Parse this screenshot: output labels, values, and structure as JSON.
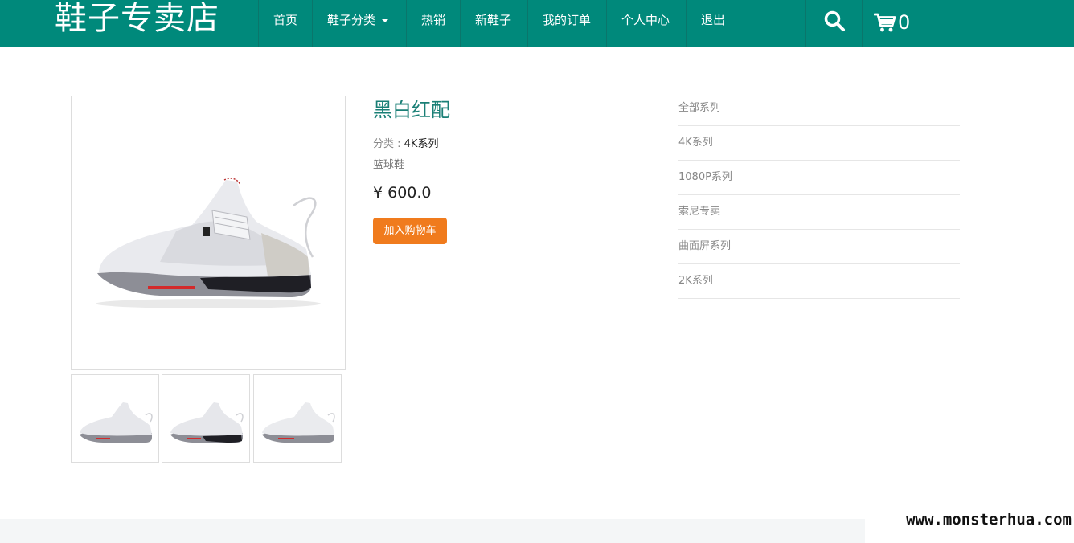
{
  "brand": "鞋子专卖店",
  "nav": {
    "items": [
      "首页",
      "鞋子分类",
      "热销",
      "新鞋子",
      "我的订单",
      "个人中心",
      "退出"
    ],
    "cart_count": "0",
    "search_icon": "search-icon",
    "cart_icon": "cart-icon"
  },
  "colors": {
    "nav_bg": "#00897b",
    "title": "#1a7f76",
    "button": "#f07b1d"
  },
  "product": {
    "title": "黑白红配",
    "category_label": "分类 : ",
    "category_value": "4K系列",
    "subtitle": "篮球鞋",
    "price": "¥ 600.0",
    "add_to_cart": "加入购物车"
  },
  "sidebar": {
    "items": [
      "全部系列",
      "4K系列",
      "1080P系列",
      "索尼专卖",
      "曲面屏系列",
      "2K系列"
    ]
  },
  "watermark": "www.monsterhua.com"
}
